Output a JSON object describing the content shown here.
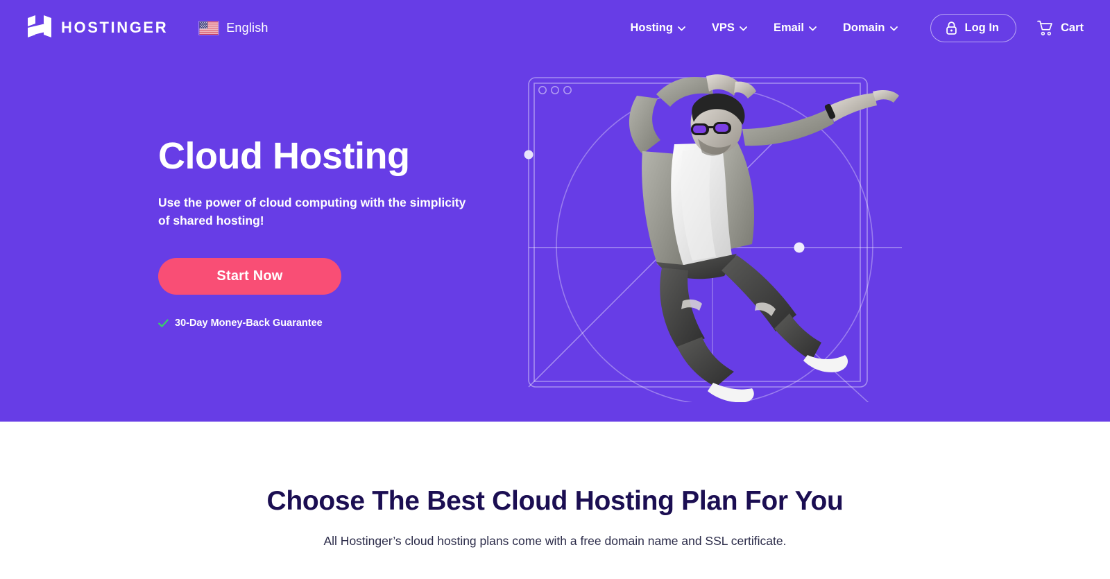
{
  "brand": {
    "name": "HOSTINGER",
    "logo_icon": "hostinger-h-logo"
  },
  "language": {
    "label": "English",
    "flag_icon": "us-flag-icon"
  },
  "nav": {
    "items": [
      {
        "label": "Hosting",
        "caret_icon": "chevron-down-icon"
      },
      {
        "label": "VPS",
        "caret_icon": "chevron-down-icon"
      },
      {
        "label": "Email",
        "caret_icon": "chevron-down-icon"
      },
      {
        "label": "Domain",
        "caret_icon": "chevron-down-icon"
      }
    ],
    "login": {
      "label": "Log In",
      "icon": "lock-icon"
    },
    "cart": {
      "label": "Cart",
      "icon": "shopping-cart-icon"
    }
  },
  "hero": {
    "title": "Cloud Hosting",
    "subtitle": "Use the power of cloud computing with the simplicity of shared hosting!",
    "cta_label": "Start Now",
    "guarantee": "30-Day Money-Back Guarantee",
    "guarantee_icon": "green-check-icon",
    "illustration_alt": "jumping-man-photo"
  },
  "plans": {
    "title": "Choose The Best Cloud Hosting Plan For You",
    "subtitle": "All Hostinger’s cloud hosting plans come with a free domain name and SSL certificate."
  },
  "colors": {
    "hero_background": "#673DE6",
    "cta_pink": "#F94E75",
    "heading_navy": "#1B0E52",
    "check_green": "#3ACB6E",
    "white": "#FFFFFF"
  }
}
